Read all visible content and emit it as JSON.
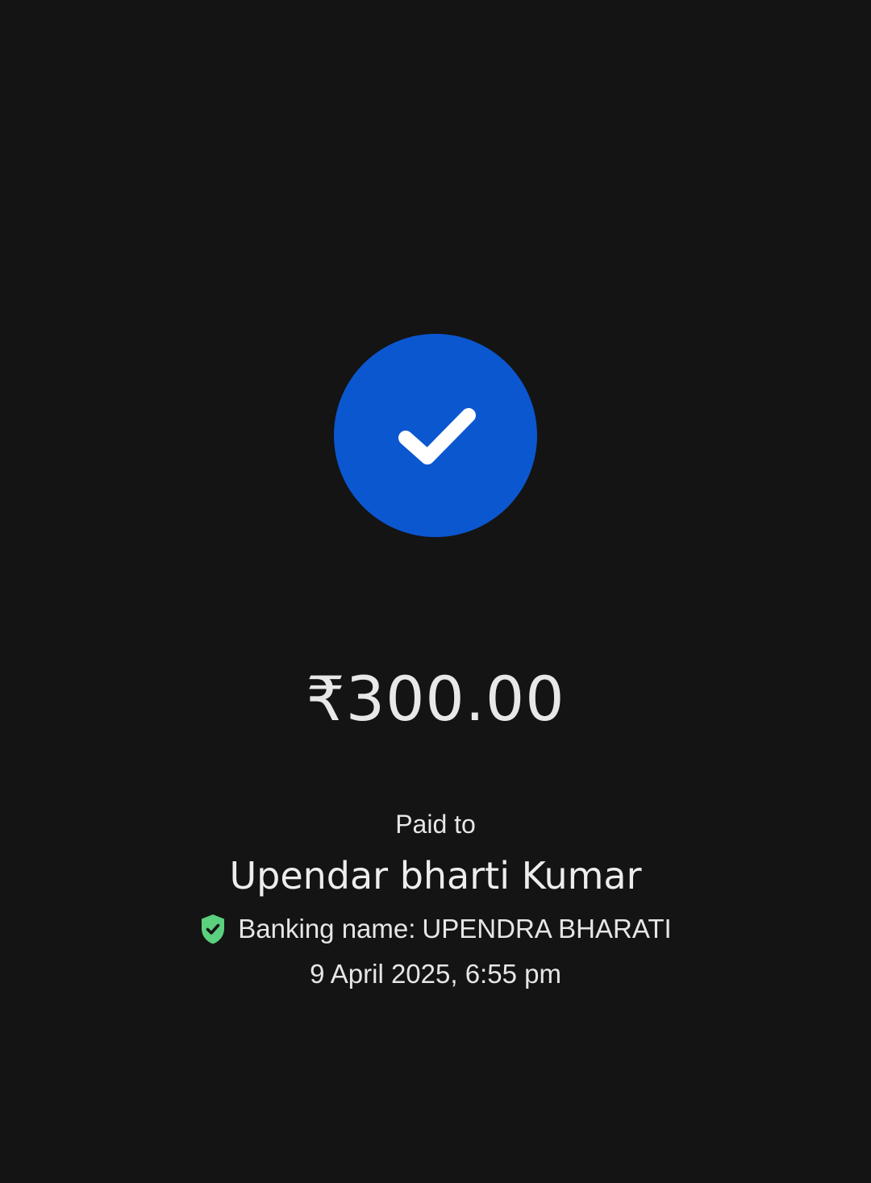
{
  "status": {
    "icon": "check-icon",
    "circle_color": "#0b57d0"
  },
  "payment": {
    "amount": "₹300.00",
    "paid_to_label": "Paid to",
    "payee_name": "Upendar bharti Kumar",
    "banking_name_label": "Banking name:",
    "banking_name_value": "UPENDRA BHARATI",
    "verified_icon": "verified-shield-icon",
    "verified_color": "#5bd07e",
    "datetime": "9 April 2025, 6:55 pm"
  }
}
